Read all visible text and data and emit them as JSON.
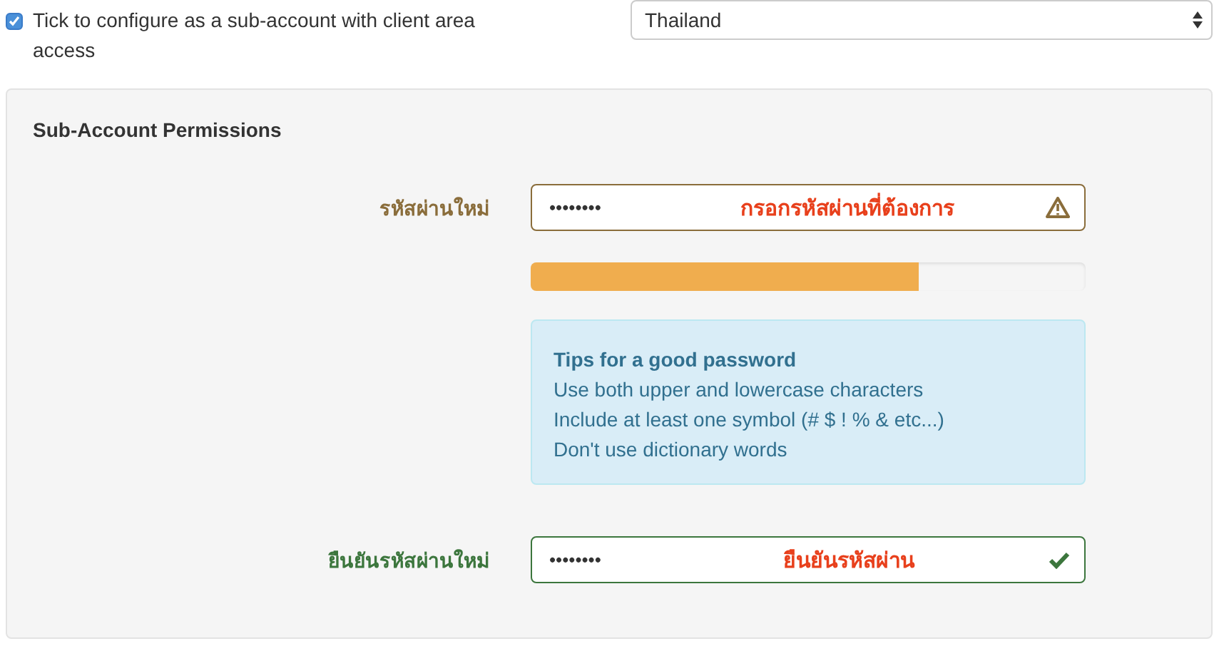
{
  "subaccount": {
    "checked": true,
    "label": "Tick to configure as a sub-account with client area access"
  },
  "country": {
    "value": "Thailand"
  },
  "permissions": {
    "title": "Sub-Account Permissions",
    "fields": [
      {
        "kind": "password",
        "label": "รหัสผ่านใหม่",
        "value": "••••••••",
        "note": "กรอกรหัสผ่านที่ต้องการ",
        "valid": false
      },
      {
        "kind": "strength",
        "level": 0.7
      },
      {
        "kind": "tips",
        "title": "Tips for a good password",
        "lines": [
          "Use both upper and lowercase characters",
          "Include at least one symbol (# $ ! % & etc...)",
          "Don't use dictionary words"
        ]
      },
      {
        "kind": "password",
        "label": "ยืนยันรหัสผ่านใหม่",
        "value": "••••••••",
        "note": "ยืนยันรหัสผ่าน",
        "valid": true
      }
    ]
  }
}
